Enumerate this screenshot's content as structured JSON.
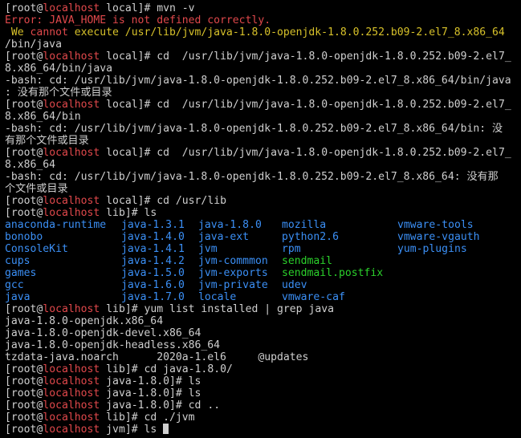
{
  "terminal": {
    "user": "root",
    "host": "localhost",
    "lines": [
      {
        "type": "prompt",
        "dir": "local",
        "cmd": "mvn -v"
      },
      {
        "type": "error",
        "label": "Error",
        "text": ": JAVA_HOME is not defined correctly."
      },
      {
        "type": "warn",
        "pre": " We ",
        "word": "cannot",
        "post": " execute /usr/lib/jvm/java-1.8.0-openjdk-1.8.0.252.b09-2.el7_8.x86_64"
      },
      {
        "type": "plain",
        "text": "/bin/java"
      },
      {
        "type": "prompt",
        "dir": "local",
        "cmd": "cd  /usr/lib/jvm/java-1.8.0-openjdk-1.8.0.252.b09-2.el7_"
      },
      {
        "type": "plain",
        "text": "8.x86_64/bin/java"
      },
      {
        "type": "plain",
        "text": "-bash: cd: /usr/lib/jvm/java-1.8.0-openjdk-1.8.0.252.b09-2.el7_8.x86_64/bin/java"
      },
      {
        "type": "plain",
        "text": ": 没有那个文件或目录"
      },
      {
        "type": "prompt",
        "dir": "local",
        "cmd": "cd  /usr/lib/jvm/java-1.8.0-openjdk-1.8.0.252.b09-2.el7_"
      },
      {
        "type": "plain",
        "text": "8.x86_64/bin"
      },
      {
        "type": "plain",
        "text": "-bash: cd: /usr/lib/jvm/java-1.8.0-openjdk-1.8.0.252.b09-2.el7_8.x86_64/bin: 没"
      },
      {
        "type": "plain",
        "text": "有那个文件或目录"
      },
      {
        "type": "prompt",
        "dir": "local",
        "cmd": "cd  /usr/lib/jvm/java-1.8.0-openjdk-1.8.0.252.b09-2.el7_"
      },
      {
        "type": "plain",
        "text": "8.x86_64"
      },
      {
        "type": "plain",
        "text": "-bash: cd: /usr/lib/jvm/java-1.8.0-openjdk-1.8.0.252.b09-2.el7_8.x86_64: 没有那"
      },
      {
        "type": "plain",
        "text": "个文件或目录"
      },
      {
        "type": "prompt",
        "dir": "local",
        "cmd": "cd /usr/lib"
      },
      {
        "type": "prompt",
        "dir": "lib",
        "cmd": "ls"
      },
      {
        "type": "ls",
        "cells": [
          {
            "t": "anaconda-runtime",
            "c": "blue"
          },
          {
            "t": "java-1.3.1",
            "c": "blue"
          },
          {
            "t": "java-1.8.0",
            "c": "blue"
          },
          {
            "t": "mozilla",
            "c": "blue"
          },
          {
            "t": "vmware-tools",
            "c": "blue"
          }
        ]
      },
      {
        "type": "ls",
        "cells": [
          {
            "t": "bonobo",
            "c": "blue"
          },
          {
            "t": "java-1.4.0",
            "c": "blue"
          },
          {
            "t": "java-ext",
            "c": "blue"
          },
          {
            "t": "python2.6",
            "c": "blue"
          },
          {
            "t": "vmware-vgauth",
            "c": "blue"
          }
        ]
      },
      {
        "type": "ls",
        "cells": [
          {
            "t": "ConsoleKit",
            "c": "blue"
          },
          {
            "t": "java-1.4.1",
            "c": "blue"
          },
          {
            "t": "jvm",
            "c": "blue"
          },
          {
            "t": "rpm",
            "c": "blue"
          },
          {
            "t": "yum-plugins",
            "c": "blue"
          }
        ]
      },
      {
        "type": "ls",
        "cells": [
          {
            "t": "cups",
            "c": "blue"
          },
          {
            "t": "java-1.4.2",
            "c": "blue"
          },
          {
            "t": "jvm-commmon",
            "c": "blue"
          },
          {
            "t": "sendmail",
            "c": "green"
          },
          {
            "t": "",
            "c": "blue"
          }
        ]
      },
      {
        "type": "ls",
        "cells": [
          {
            "t": "games",
            "c": "blue"
          },
          {
            "t": "java-1.5.0",
            "c": "blue"
          },
          {
            "t": "jvm-exports",
            "c": "blue"
          },
          {
            "t": "sendmail.postfix",
            "c": "green"
          },
          {
            "t": "",
            "c": "blue"
          }
        ]
      },
      {
        "type": "ls",
        "cells": [
          {
            "t": "gcc",
            "c": "blue"
          },
          {
            "t": "java-1.6.0",
            "c": "blue"
          },
          {
            "t": "jvm-private",
            "c": "blue"
          },
          {
            "t": "udev",
            "c": "blue"
          },
          {
            "t": "",
            "c": "blue"
          }
        ]
      },
      {
        "type": "ls",
        "cells": [
          {
            "t": "java",
            "c": "blue"
          },
          {
            "t": "java-1.7.0",
            "c": "blue"
          },
          {
            "t": "locale",
            "c": "blue"
          },
          {
            "t": "vmware-caf",
            "c": "blue"
          },
          {
            "t": "",
            "c": "blue"
          }
        ]
      },
      {
        "type": "prompt",
        "dir": "lib",
        "cmd": "yum list installed | grep java"
      },
      {
        "type": "plain",
        "text": "java-1.8.0-openjdk.x86_64"
      },
      {
        "type": "plain",
        "text": "java-1.8.0-openjdk-devel.x86_64"
      },
      {
        "type": "plain",
        "text": "java-1.8.0-openjdk-headless.x86_64"
      },
      {
        "type": "plain",
        "text": "tzdata-java.noarch      2020a-1.el6     @updates"
      },
      {
        "type": "prompt",
        "dir": "lib",
        "cmd": "cd java-1.8.0/"
      },
      {
        "type": "prompt",
        "dir": "java-1.8.0",
        "cmd": "ls"
      },
      {
        "type": "prompt",
        "dir": "java-1.8.0",
        "cmd": "ls"
      },
      {
        "type": "prompt",
        "dir": "java-1.8.0",
        "cmd": "cd .."
      },
      {
        "type": "prompt",
        "dir": "lib",
        "cmd": "cd ./jvm"
      },
      {
        "type": "prompt",
        "dir": "jvm",
        "cmd": "ls"
      }
    ]
  },
  "colors": {
    "background": "#000000",
    "foreground": "#cfcfcf",
    "host": "#e0484b",
    "error": "#e0484b",
    "warning": "#d8c22a",
    "directory": "#3b8ff5",
    "executable": "#2bd02b"
  }
}
